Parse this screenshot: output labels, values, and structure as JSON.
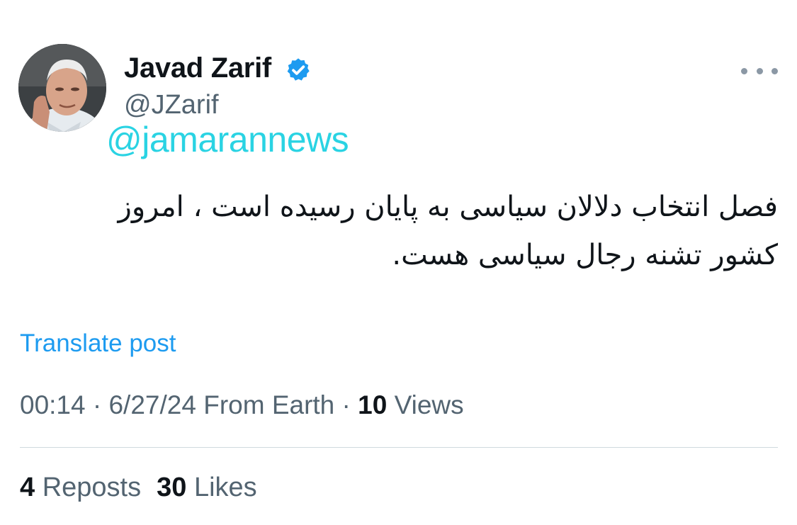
{
  "author": {
    "display_name": "Javad Zarif",
    "handle": "@JZarif",
    "verified": true,
    "avatar_icon": "user-avatar",
    "verified_icon": "verified-badge-icon"
  },
  "watermark": "@jamarannews",
  "tweet": {
    "text_line1": "فصل انتخاب دلالان سیاسی به پایان رسیده است ، امروز",
    "text_line2": "کشور تشنه رجال سیاسی هست."
  },
  "translate_label": "Translate post",
  "meta": {
    "time": "00:14",
    "separator": " · ",
    "date": "6/27/24",
    "source": "From Earth",
    "views_count": "10",
    "views_label": "Views"
  },
  "stats": {
    "reposts_count": "4",
    "reposts_label": "Reposts",
    "likes_count": "30",
    "likes_label": "Likes"
  },
  "colors": {
    "accent": "#1d9bf0",
    "secondary_text": "#536471",
    "primary_text": "#0f1419",
    "watermark": "#2ad3e3",
    "divider": "#cfd9de"
  }
}
